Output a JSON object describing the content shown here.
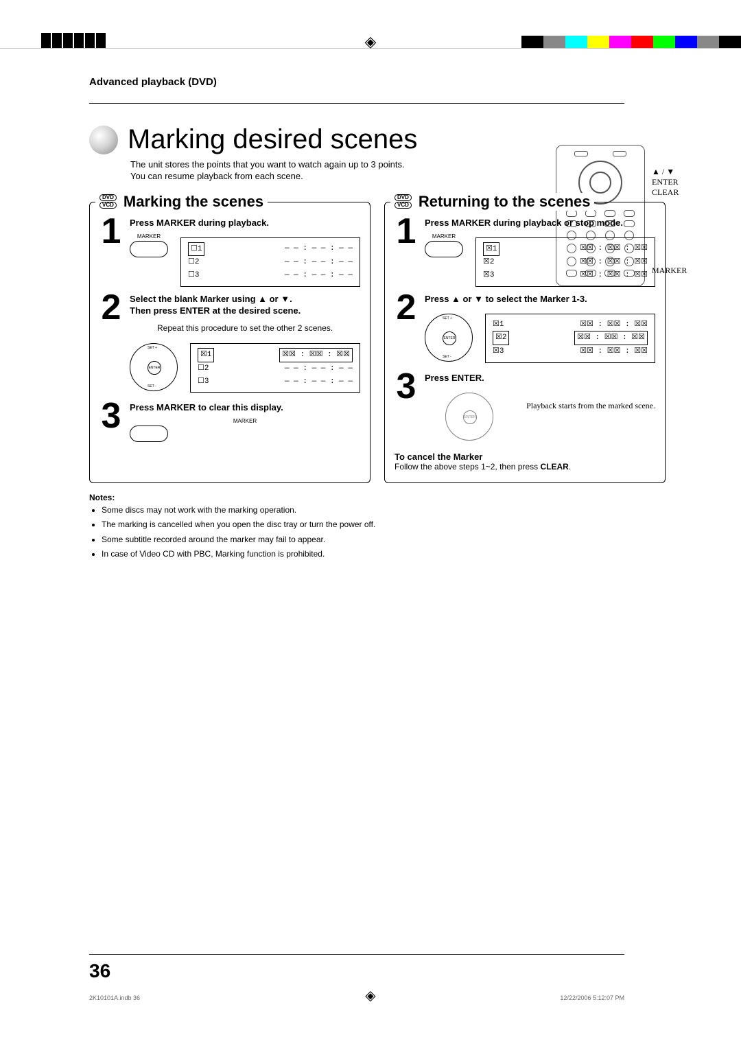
{
  "header": {
    "section": "Advanced playback (DVD)"
  },
  "title": "Marking desired scenes",
  "intro": "The unit stores the points that you want to watch again up to 3 points. You can resume playback from each scene.",
  "remote_labels": {
    "arrows_enter": "▲ / ▼\nENTER\nCLEAR",
    "marker": "MARKER"
  },
  "left": {
    "heading": "Marking the scenes",
    "badge_top": "DVD",
    "badge_bot": "VCD",
    "step1": {
      "title": "Press MARKER during playback.",
      "btn_label": "MARKER",
      "osd_rows": [
        {
          "left": "☐1",
          "right": "— — : — — : — —"
        },
        {
          "left": "☐2",
          "right": "— — : — — : — —"
        },
        {
          "left": "☐3",
          "right": "— — : — — : — —"
        }
      ]
    },
    "step2": {
      "title": "Select the blank Marker using ▲ or ▼.\nThen press ENTER at the desired scene.",
      "sub": "Repeat this procedure to set the other 2 scenes.",
      "osd_rows": [
        {
          "left": "☒1",
          "right": "☒☒ : ☒☒ : ☒☒",
          "hl": true
        },
        {
          "left": "☐2",
          "right": "— — : — — : — —"
        },
        {
          "left": "☐3",
          "right": "— — : — — : — —"
        }
      ]
    },
    "step3": {
      "title": "Press MARKER to clear this display.",
      "btn_label": "MARKER"
    }
  },
  "right": {
    "heading": "Returning to the scenes",
    "badge_top": "DVD",
    "badge_bot": "VCD",
    "step1": {
      "title": "Press MARKER during playback or stop mode.",
      "btn_label": "MARKER",
      "osd_rows": [
        {
          "left": "☒1",
          "right": "☒☒ : ☒☒ : ☒☒",
          "hl": true
        },
        {
          "left": "☒2",
          "right": "☒☒ : ☒☒ : ☒☒"
        },
        {
          "left": "☒3",
          "right": "☒☒ : ☒☒ : ☒☒"
        }
      ]
    },
    "step2": {
      "title": "Press ▲ or ▼ to select the Marker 1-3.",
      "osd_rows": [
        {
          "left": "☒1",
          "right": "☒☒ : ☒☒ : ☒☒"
        },
        {
          "left": "☒2",
          "right": "☒☒ : ☒☒ : ☒☒",
          "hl": true
        },
        {
          "left": "☒3",
          "right": "☒☒ : ☒☒ : ☒☒"
        }
      ]
    },
    "step3": {
      "title": "Press ENTER.",
      "sub": "Playback starts from the marked scene."
    },
    "cancel": {
      "heading": "To cancel the Marker",
      "body_a": "Follow the above steps 1~2, then press ",
      "body_b": "CLEAR",
      "body_c": "."
    }
  },
  "notes": {
    "heading": "Notes:",
    "items": [
      "Some discs may not work with the marking operation.",
      "The marking is cancelled when you open the disc tray or turn the power off.",
      "Some subtitle recorded around the marker may fail to appear.",
      "In case of Video CD with PBC, Marking function is prohibited."
    ]
  },
  "page_number": "36",
  "footer": {
    "left": "2K10101A.indb   36",
    "right": "12/22/2006   5:12:07 PM"
  },
  "pad_labels": {
    "up": "SET +",
    "down": "SET -",
    "center": "ENTER"
  }
}
